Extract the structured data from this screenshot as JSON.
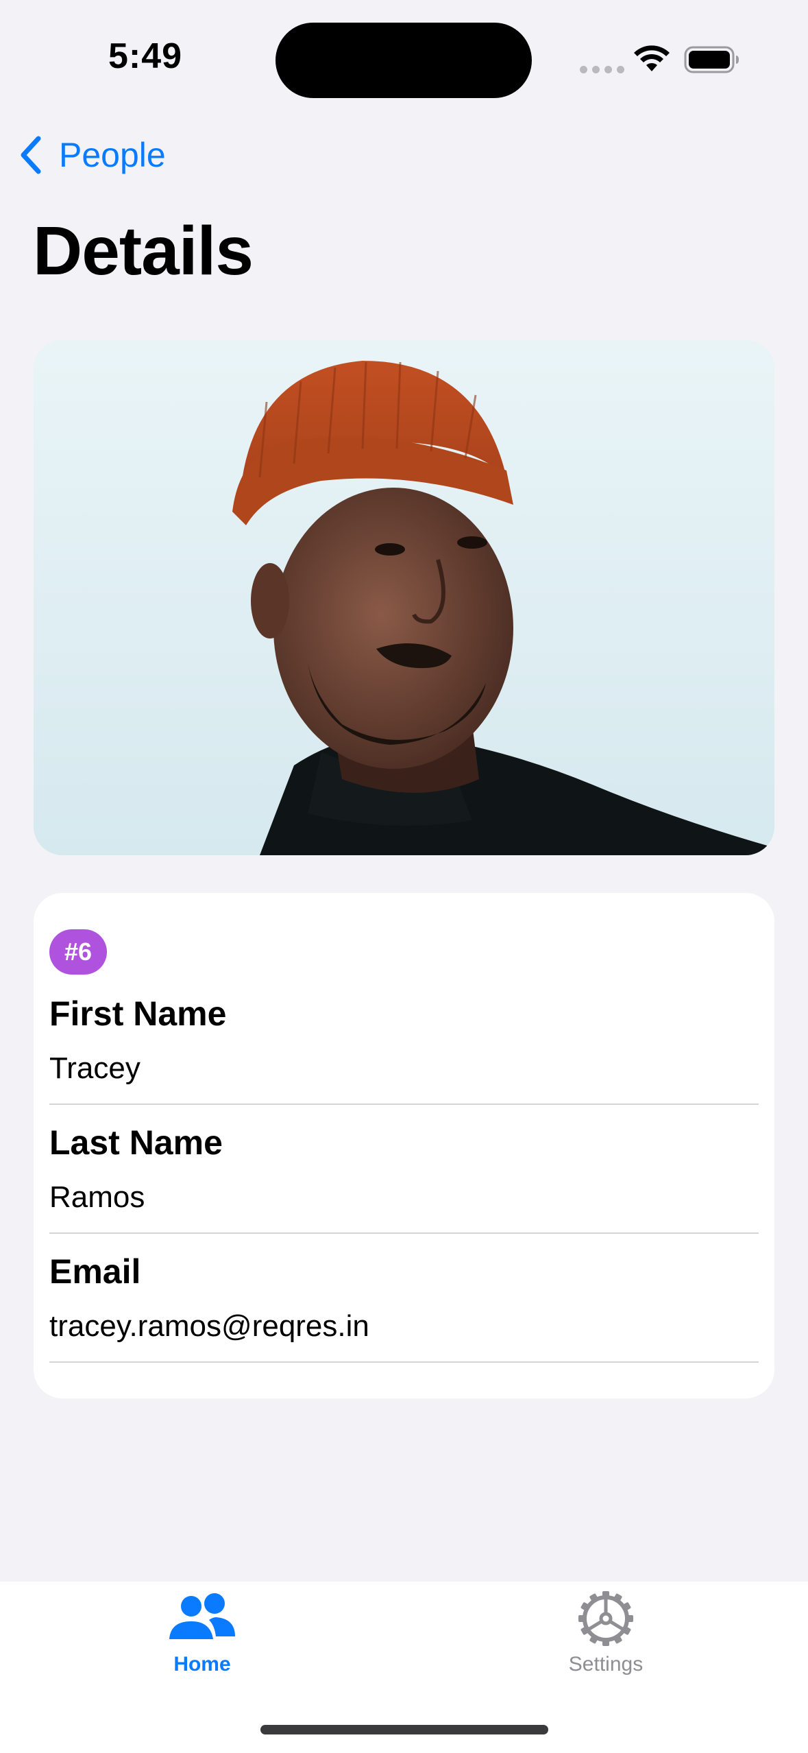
{
  "status_bar": {
    "time": "5:49"
  },
  "nav": {
    "back_label": "People",
    "title": "Details"
  },
  "person": {
    "id_badge": "#6",
    "fields": [
      {
        "label": "First Name",
        "value": "Tracey"
      },
      {
        "label": "Last Name",
        "value": "Ramos"
      },
      {
        "label": "Email",
        "value": "tracey.ramos@reqres.in"
      }
    ]
  },
  "tabs": [
    {
      "label": "Home",
      "icon": "people-icon",
      "selected": true
    },
    {
      "label": "Settings",
      "icon": "gear-icon",
      "selected": false
    }
  ],
  "colors": {
    "accent": "#0a7aff",
    "badge": "#af52de",
    "background": "#f2f2f7",
    "inactive_tab": "#8e8e93"
  }
}
